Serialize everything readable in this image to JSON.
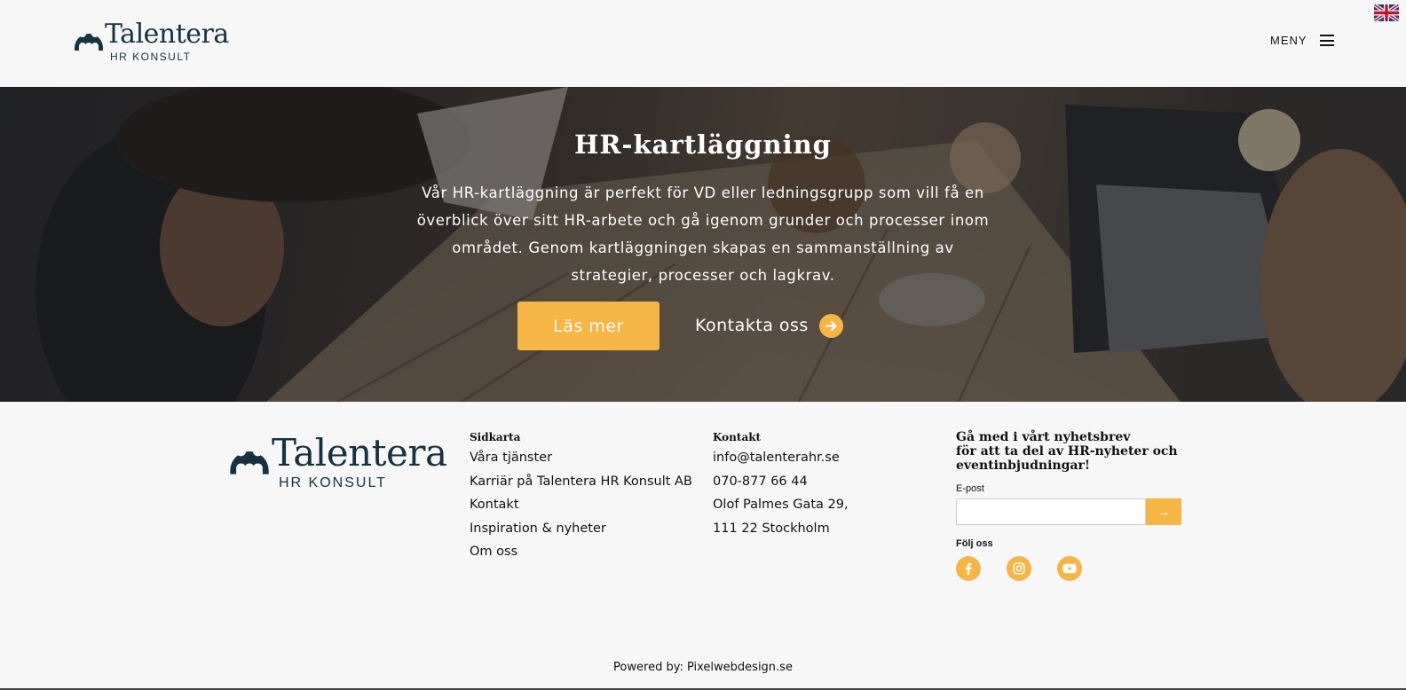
{
  "header": {
    "logo": {
      "name": "Talentera",
      "sub": "HR KONSULT"
    },
    "menu_label": "MENY"
  },
  "hero": {
    "title": "HR-kartläggning",
    "text": "Vår HR-kartläggning är perfekt för VD eller ledningsgrupp som vill få en överblick över sitt HR-arbete och gå igenom grunder och processer inom området. Genom kartläggningen skapas en sammanställning av strategier, processer och lagkrav.",
    "primary_button": "Läs mer",
    "secondary_button": "Kontakta oss"
  },
  "footer": {
    "logo": {
      "name": "Talentera",
      "sub": "HR KONSULT"
    },
    "sitemap": {
      "heading": "Sidkarta",
      "links": [
        "Våra tjänster",
        "Karriär på Talentera HR Konsult AB",
        "Kontakt",
        "Inspiration & nyheter",
        "Om oss"
      ]
    },
    "contact": {
      "heading": "Kontakt",
      "email": "info@talenterahr.se",
      "phone": "070-877 66 44",
      "address_line1": "Olof Palmes Gata 29,",
      "address_line2": "111 22 Stockholm"
    },
    "newsletter": {
      "heading_line1": "Gå med i vårt nyhetsbrev",
      "heading_line2": "för att ta del av HR-nyheter och",
      "heading_line3": "eventinbjudningar!",
      "email_label": "E-post",
      "email_value": "",
      "submit": "→",
      "follow_label": "Följ oss"
    },
    "powered_prefix": "Powered by: ",
    "powered_link": "Pixelwebdesign.se"
  },
  "icons": {
    "flag": "uk-flag-icon",
    "menu": "hamburger-icon",
    "arrow": "arrow-right-circle-icon",
    "social": [
      "facebook-icon",
      "instagram-icon",
      "youtube-icon"
    ]
  },
  "colors": {
    "accent": "#f7b544",
    "brand_dark": "#16323f",
    "background": "#f7f7f7"
  }
}
